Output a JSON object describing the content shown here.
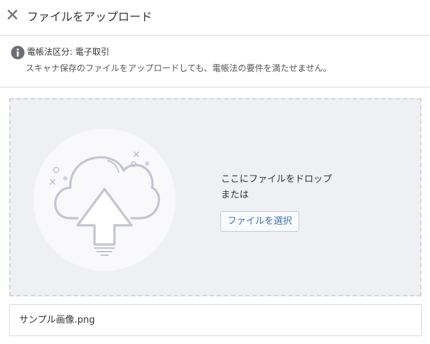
{
  "header": {
    "title": "ファイルをアップロード",
    "close_icon": "close-icon"
  },
  "notice": {
    "icon": "info-icon",
    "label": "電帳法区分: 電子取引",
    "message": "スキャナ保存のファイルをアップロードしても、電帳法の要件を満たせません。"
  },
  "dropzone": {
    "illustration": "cloud-upload-icon",
    "drop_text": "ここにファイルをドロップ",
    "or_text": "または",
    "select_label": "ファイルを選択"
  },
  "file": {
    "name": "サンプル画像.png"
  },
  "colors": {
    "dropzone_bg": "#eff0f4",
    "dropzone_border": "#d3d5da",
    "button_text": "#3f74b8",
    "info_icon": "#6b6e75",
    "illustration_stroke": "#c3c5cf"
  }
}
